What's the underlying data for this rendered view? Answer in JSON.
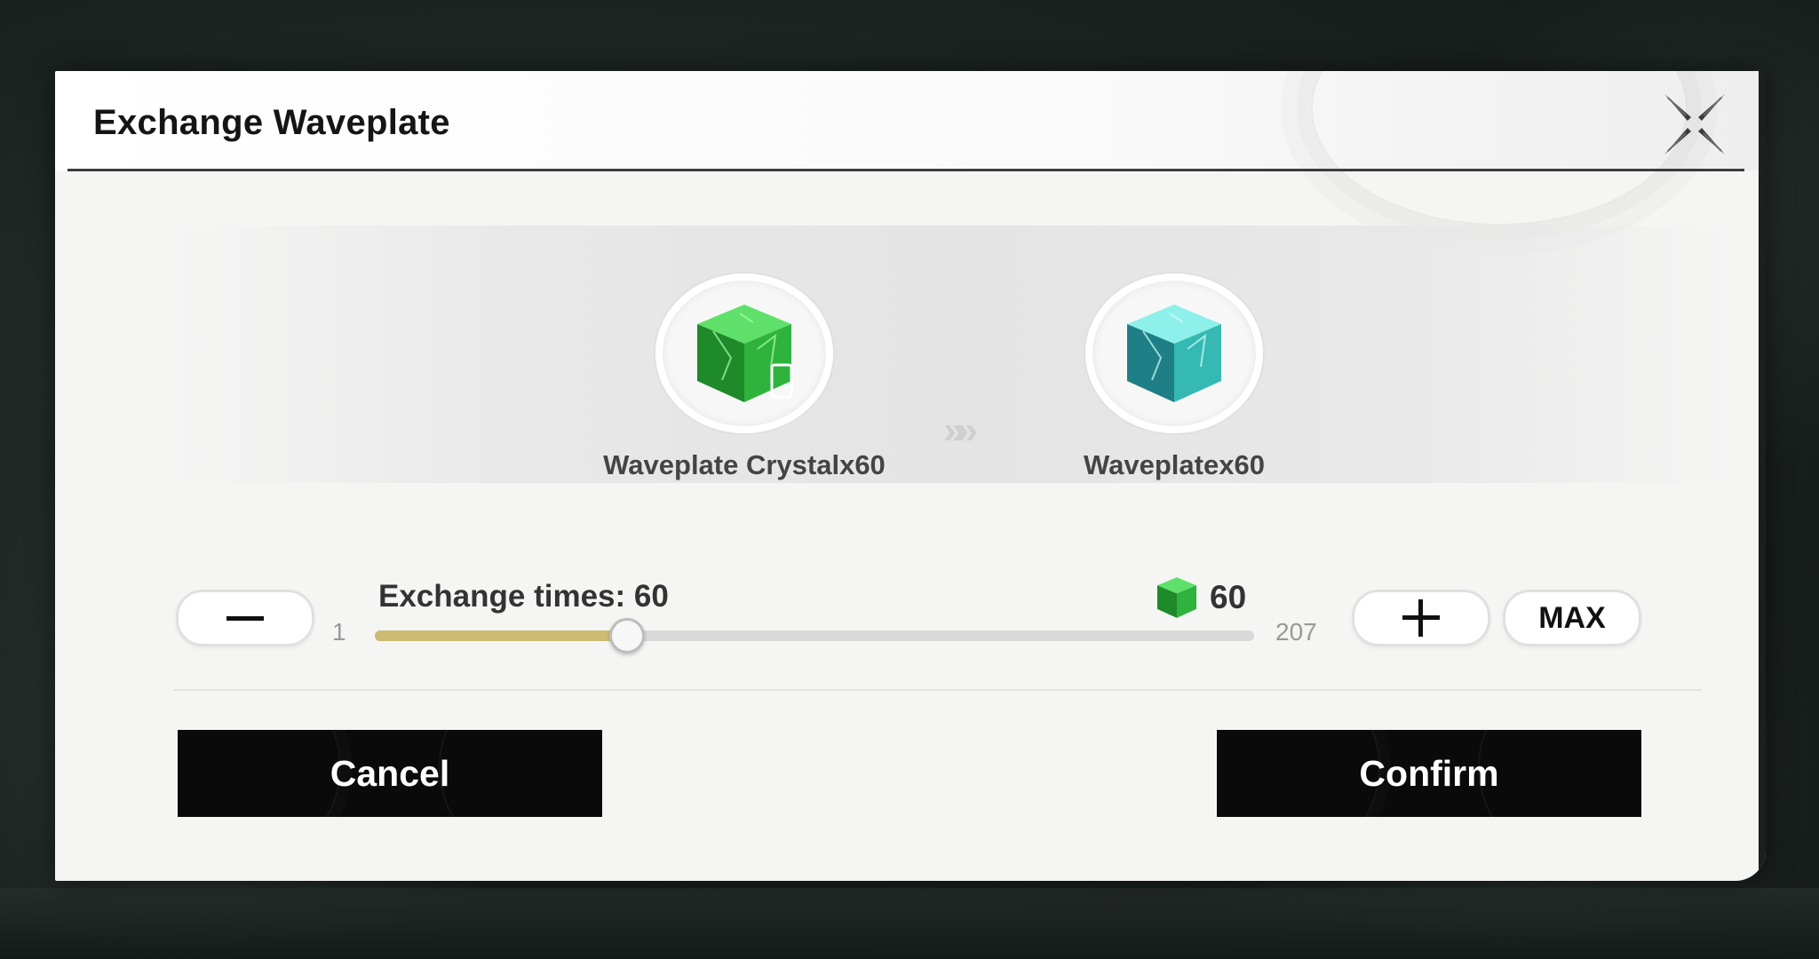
{
  "dialog": {
    "title": "Exchange Waveplate"
  },
  "exchange": {
    "source_label": "Waveplate Crystalx60",
    "target_label": "Waveplatex60",
    "arrow": "»"
  },
  "quantity": {
    "label": "Exchange times: 60",
    "cost_value": "60",
    "min": "1",
    "max": "207",
    "current": 60,
    "minus_icon": "minus-icon",
    "plus_icon": "plus-icon",
    "max_label": "MAX"
  },
  "actions": {
    "cancel_label": "Cancel",
    "confirm_label": "Confirm"
  },
  "colors": {
    "slider_fill": "#cdbb72",
    "button_bg": "#0a0a0a",
    "crystal_green": "#2fbf3f",
    "waveplate_teal": "#35b9b2"
  }
}
